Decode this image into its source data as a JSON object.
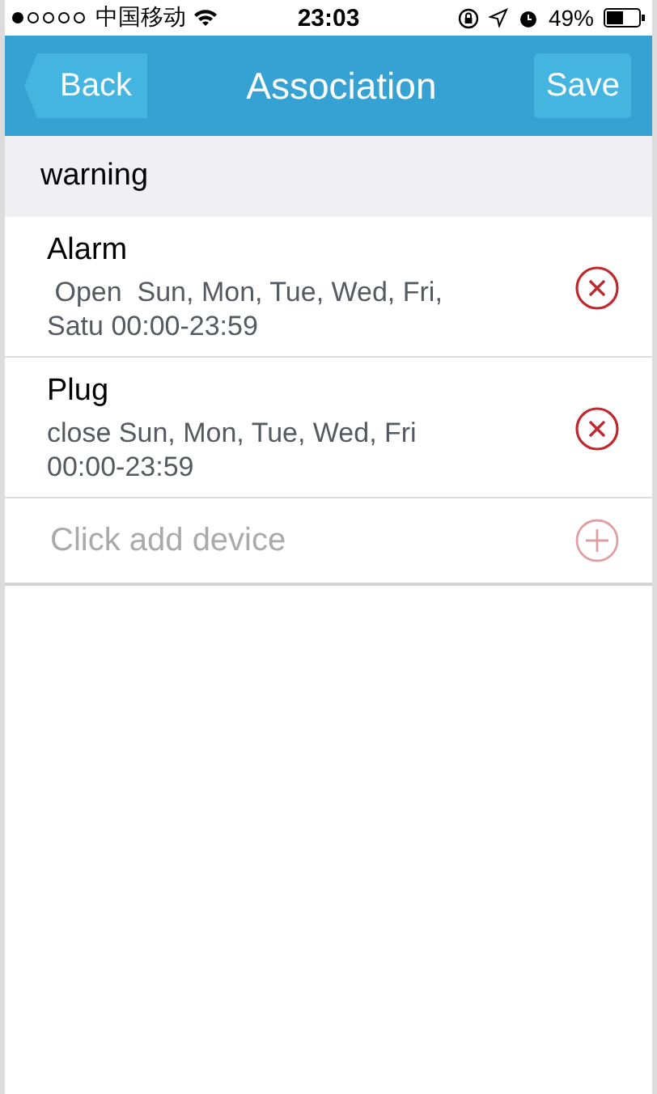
{
  "status_bar": {
    "carrier": "中国移动",
    "time": "23:03",
    "battery": "49%"
  },
  "nav": {
    "back": "Back",
    "title": "Association",
    "save": "Save"
  },
  "section": {
    "title": "warning"
  },
  "devices": [
    {
      "name": "Alarm",
      "detail": " Open  Sun, Mon, Tue, Wed, Fri, Satu 00:00-23:59"
    },
    {
      "name": "Plug",
      "detail": "close Sun, Mon, Tue, Wed, Fri 00:00-23:59"
    }
  ],
  "add_row": {
    "placeholder": "Click add device"
  }
}
